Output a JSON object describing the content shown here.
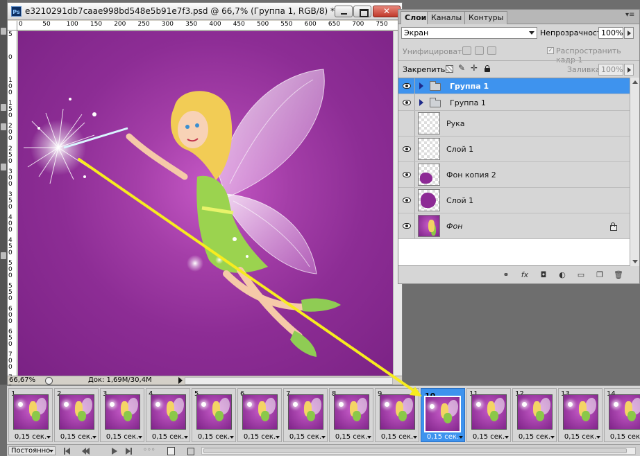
{
  "document": {
    "title": "e3210291db7caae998bd548e5b91e7f3.psd @ 66,7% (Группа 1, RGB/8) *",
    "ps_icon": "Ps",
    "close_glyph": "✕",
    "zoom": "66,67%",
    "doc_info": "Док: 1,69M/30,4M",
    "ruler_h": [
      "0",
      "50",
      "100",
      "150",
      "200",
      "250",
      "300",
      "350",
      "400",
      "450",
      "500",
      "550",
      "600",
      "650",
      "700",
      "750"
    ],
    "ruler_v": [
      "5",
      "0",
      "1 0 0",
      "1 5 0",
      "2 0 0",
      "2 5 0",
      "3 0 0",
      "3 5 0",
      "4 0 0",
      "4 5 0",
      "5 0 0",
      "5 5 0",
      "6 0 0",
      "6 5 0",
      "7 0 0",
      "7 5 0"
    ]
  },
  "panel": {
    "tabs": [
      "Слои",
      "Каналы",
      "Контуры"
    ],
    "active_tab": "Слои",
    "blend_mode": "Экран",
    "opacity_label": "Непрозрачность:",
    "opacity_value": "100%",
    "unify_label": "Унифицировать:",
    "propagate_label": "Распространить кадр 1",
    "lock_label": "Закрепить:",
    "fill_label": "Заливка:",
    "fill_value": "100%",
    "layers": [
      {
        "name": "Группа 1",
        "type": "group",
        "visible": true,
        "selected": true
      },
      {
        "name": "Группа 1",
        "type": "group",
        "visible": true,
        "selected": false
      },
      {
        "name": "Рука",
        "type": "layer",
        "visible": false,
        "selected": false
      },
      {
        "name": "Слой 1",
        "type": "layer",
        "visible": true,
        "selected": false
      },
      {
        "name": "Фон копия 2",
        "type": "layer",
        "visible": true,
        "selected": false
      },
      {
        "name": "Слой 1",
        "type": "layer",
        "visible": true,
        "selected": false
      },
      {
        "name": "Фон",
        "type": "background",
        "visible": true,
        "selected": false,
        "locked": true
      }
    ],
    "footer_icons": [
      "link-icon",
      "fx-icon",
      "mask-icon",
      "adjustment-icon",
      "folder-icon",
      "new-layer-icon",
      "trash-icon"
    ],
    "footer_glyphs": [
      "⚭",
      "fx",
      "◘",
      "◐",
      "▭",
      "❐",
      "🗑"
    ]
  },
  "timeline": {
    "frames": [
      {
        "num": "1",
        "time": "0,15 сек."
      },
      {
        "num": "2",
        "time": "0,15 сек."
      },
      {
        "num": "3",
        "time": "0,15 сек."
      },
      {
        "num": "4",
        "time": "0,15 сек."
      },
      {
        "num": "5",
        "time": "0,15 сек."
      },
      {
        "num": "6",
        "time": "0,15 сек."
      },
      {
        "num": "7",
        "time": "0,15 сек."
      },
      {
        "num": "8",
        "time": "0,15 сек."
      },
      {
        "num": "9",
        "time": "0,15 сек."
      },
      {
        "num": "10",
        "time": "0,15 сек.",
        "selected": true
      },
      {
        "num": "11",
        "time": "0,15 сек."
      },
      {
        "num": "12",
        "time": "0,15 сек."
      },
      {
        "num": "13",
        "time": "0,15 сек."
      },
      {
        "num": "14",
        "time": "0,15 сек."
      }
    ],
    "loop": "Постоянно",
    "tween_glyph": "◦◦◦"
  },
  "annotation": {
    "color": "#f7ec1f"
  }
}
